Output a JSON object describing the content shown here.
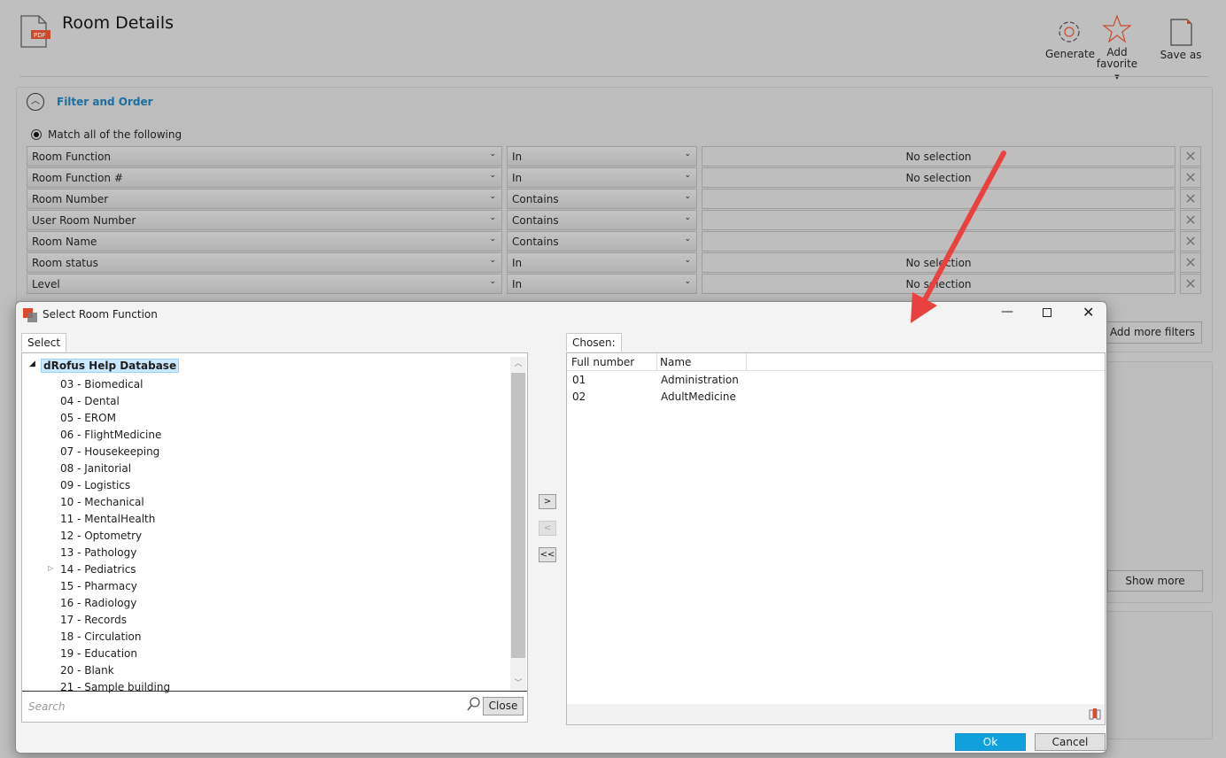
{
  "header": {
    "title": "Room Details",
    "pdf_label": "PDF"
  },
  "toolbar": {
    "generate": "Generate",
    "add_favorite": "Add favorite",
    "add_favorite_line1": "Add",
    "add_favorite_line2": "favorite",
    "save_as": "Save as"
  },
  "filter": {
    "section_title": "Filter and Order",
    "match_label": "Match all of the following",
    "rows": [
      {
        "field": "Room Function",
        "operator": "In",
        "value": "No selection"
      },
      {
        "field": "Room Function #",
        "operator": "In",
        "value": "No selection"
      },
      {
        "field": "Room Number",
        "operator": "Contains",
        "value": ""
      },
      {
        "field": "User Room Number",
        "operator": "Contains",
        "value": ""
      },
      {
        "field": "Room Name",
        "operator": "Contains",
        "value": ""
      },
      {
        "field": "Room status",
        "operator": "In",
        "value": "No selection"
      },
      {
        "field": "Level",
        "operator": "In",
        "value": "No selection"
      }
    ],
    "add_more": "Add more filters",
    "show_more": "Show more"
  },
  "dialog": {
    "title": "Select Room Function",
    "select_tab": "Select",
    "chosen_tab": "Chosen:",
    "root": "dRofus Help Database",
    "tree": [
      "03 - Biomedical",
      "04 - Dental",
      "05 - EROM",
      "06 - FlightMedicine",
      "07 - Housekeeping",
      "08 - Janitorial",
      "09 - Logistics",
      "10 - Mechanical",
      "11 - MentalHealth",
      "12 - Optometry",
      "13 - Pathology",
      "14 - Pediatrics",
      "15 - Pharmacy",
      "16 - Radiology",
      "17 - Records",
      "18 - Circulation",
      "19 - Education",
      "20 - Blank",
      "21 - Sample building"
    ],
    "search_placeholder": "Search",
    "close": "Close",
    "add": ">",
    "remove": "<",
    "remove_all": "<<",
    "columns": [
      "Full number",
      "Name"
    ],
    "chosen": [
      {
        "number": "01",
        "name": "Administration"
      },
      {
        "number": "02",
        "name": "AdultMedicine"
      }
    ],
    "ok": "Ok",
    "cancel": "Cancel"
  },
  "colors": {
    "accent": "#1a9fd8",
    "link": "#1a6fa0",
    "arrow": "#e8413f",
    "brand": "#d9472b"
  }
}
